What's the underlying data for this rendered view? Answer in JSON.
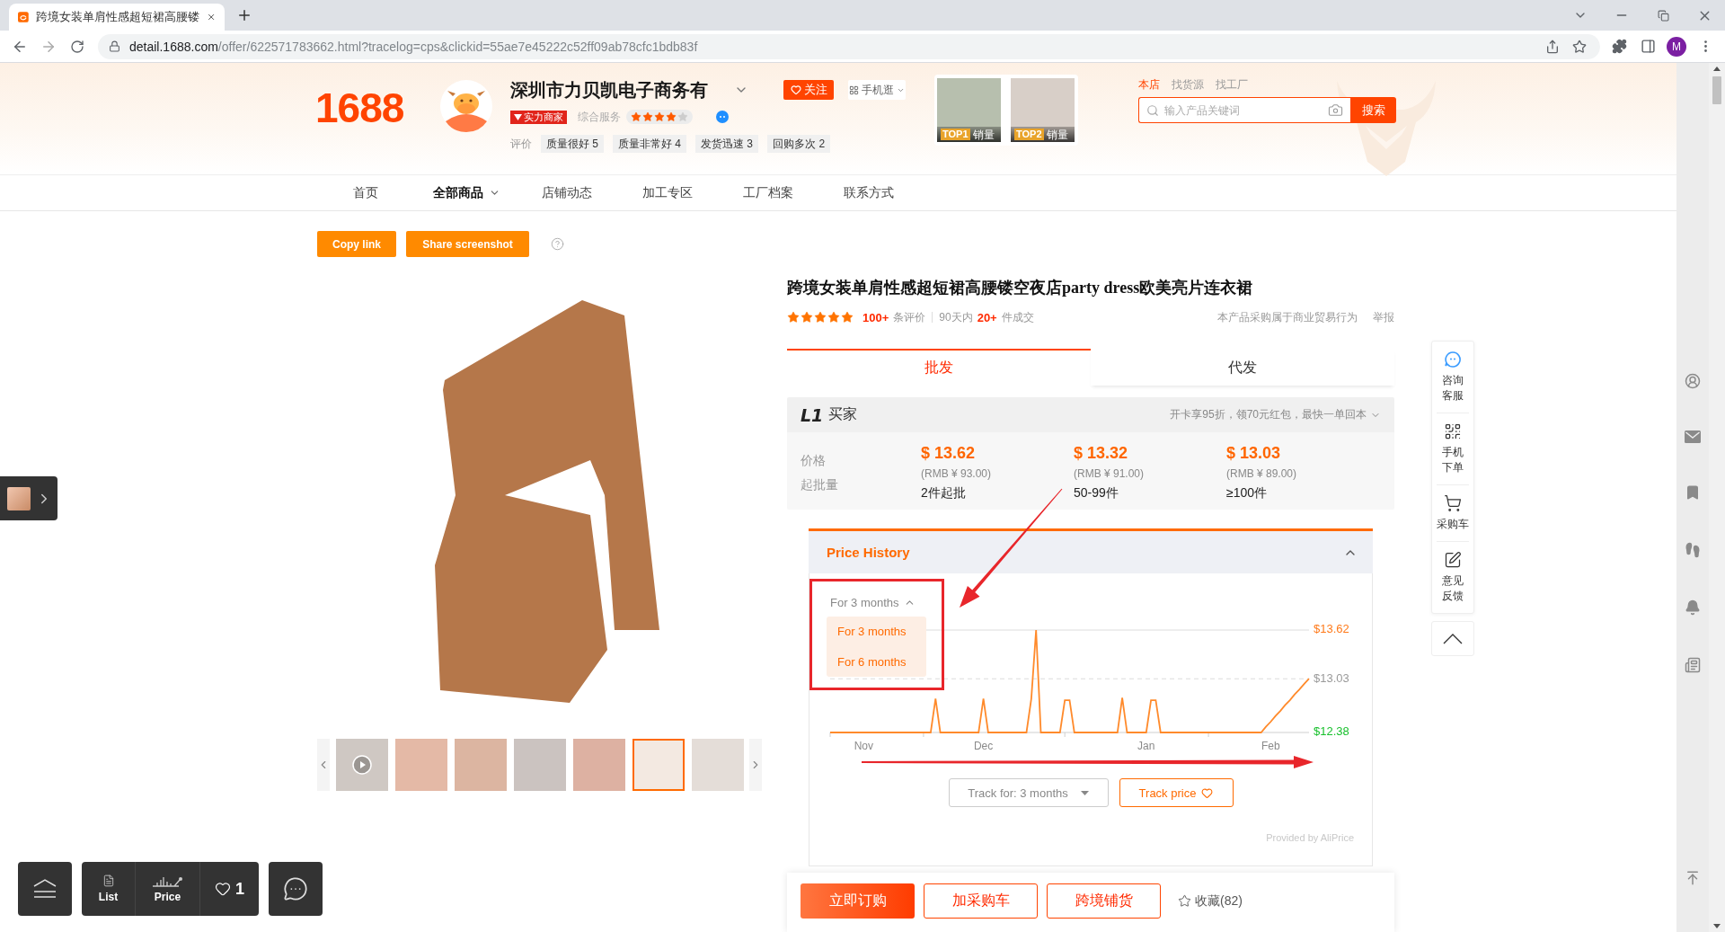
{
  "browser": {
    "tab_title": "跨境女装单肩性感超短裙高腰镂",
    "url": "detail.1688.com/offer/622571783662.html?tracelog=cps&clickid=55ae7e45222c52ff09ab78cfc1bdb83f",
    "profile_initial": "M"
  },
  "store": {
    "logo": "1688",
    "name": "深圳市力贝凯电子商务有",
    "badge": "实力商家",
    "service": {
      "label": "综合服务",
      "stars": 4
    },
    "follow": "关注",
    "mobile": "手机逛",
    "reviews_label": "评价",
    "review_tags": [
      "质量很好 5",
      "质量非常好 4",
      "发货迅速 3",
      "回购多次 2"
    ],
    "top_products": [
      {
        "rank": "TOP1",
        "metric": "销量"
      },
      {
        "rank": "TOP2",
        "metric": "销量"
      }
    ]
  },
  "search": {
    "scopes": [
      {
        "label": "本店",
        "selected": true
      },
      {
        "label": "找货源",
        "selected": false
      },
      {
        "label": "找工厂",
        "selected": false
      }
    ],
    "placeholder": "输入产品关键词",
    "button": "搜索"
  },
  "nav": [
    {
      "label": "首页",
      "selected": false,
      "has_menu": false
    },
    {
      "label": "全部商品",
      "selected": true,
      "has_menu": true
    },
    {
      "label": "店铺动态",
      "selected": false,
      "has_menu": false
    },
    {
      "label": "加工专区",
      "selected": false,
      "has_menu": false
    },
    {
      "label": "工厂档案",
      "selected": false,
      "has_menu": false
    },
    {
      "label": "联系方式",
      "selected": false,
      "has_menu": false
    }
  ],
  "share_buttons": [
    "Copy link",
    "Share screenshot"
  ],
  "gallery": {
    "thumbnails": [
      {
        "kind": "video",
        "selected": false
      },
      {
        "kind": "photo",
        "selected": false
      },
      {
        "kind": "photo",
        "selected": false
      },
      {
        "kind": "photo",
        "selected": false
      },
      {
        "kind": "photo",
        "selected": false
      },
      {
        "kind": "photo",
        "selected": true
      },
      {
        "kind": "photo",
        "selected": false
      }
    ]
  },
  "product": {
    "title": "跨境女装单肩性感超短裙高腰镂空夜店party dress欧美亮片连衣裙",
    "stars": 5,
    "review_count": "100+",
    "review_label": "条评价",
    "period": "90天内",
    "sold_count": "20+",
    "sold_label": "件成交",
    "notice": "本产品采购属于商业贸易行为",
    "report": "举报"
  },
  "mode_tabs": [
    {
      "label": "批发",
      "selected": true
    },
    {
      "label": "代发",
      "selected": false
    }
  ],
  "price_panel": {
    "member_level": "L1",
    "member_label": "买家",
    "promo": "开卡享95折，领70元红包，最快一单回本",
    "row_labels": [
      "价格",
      "起批量"
    ],
    "tiers": [
      {
        "price": "$ 13.62",
        "rmb": "(RMB ¥ 93.00)",
        "quantity": "2件起批"
      },
      {
        "price": "$ 13.32",
        "rmb": "(RMB ¥ 91.00)",
        "quantity": "50-99件"
      },
      {
        "price": "$ 13.03",
        "rmb": "(RMB ¥ 89.00)",
        "quantity": "≥100件"
      }
    ]
  },
  "price_history": {
    "title": "Price History",
    "expanded": true,
    "period": "For 3 months",
    "period_menu_open": true,
    "period_options": [
      "For 3 months",
      "For 6 months"
    ],
    "chart_data": {
      "type": "line",
      "categories": [
        null,
        null,
        null,
        null,
        null,
        null,
        null,
        "Nov",
        null,
        null,
        null,
        null,
        null,
        null,
        null,
        null,
        null,
        null,
        null,
        null,
        null,
        null,
        null,
        null,
        null,
        null,
        null,
        null,
        null,
        null,
        null,
        null,
        "Dec",
        null,
        null,
        null,
        null,
        null,
        null,
        null,
        null,
        null,
        null,
        null,
        null,
        null,
        null,
        null,
        null,
        null,
        null,
        null,
        null,
        null,
        null,
        null,
        null,
        null,
        null,
        null,
        null,
        null,
        null,
        null,
        null,
        null,
        "Jan",
        null,
        null,
        null,
        null,
        null,
        null,
        null,
        null,
        null,
        null,
        null,
        null,
        null,
        null,
        null,
        null,
        null,
        null,
        null,
        null,
        null,
        null,
        null,
        null,
        null,
        "Feb",
        null,
        null,
        null,
        null,
        null,
        null,
        null,
        null
      ],
      "series": [
        {
          "color": "#ff8a2b",
          "values": [
            12.38,
            12.38,
            12.38,
            12.38,
            12.38,
            12.38,
            12.38,
            12.38,
            12.38,
            12.38,
            12.38,
            12.38,
            12.38,
            12.38,
            12.38,
            12.38,
            12.38,
            12.38,
            12.38,
            12.38,
            12.38,
            12.38,
            12.79,
            12.38,
            12.38,
            12.38,
            12.38,
            12.38,
            12.38,
            12.38,
            12.38,
            12.38,
            12.79,
            12.38,
            12.38,
            12.38,
            12.38,
            12.38,
            12.38,
            12.38,
            12.38,
            12.38,
            12.79,
            13.62,
            12.38,
            12.38,
            12.38,
            12.38,
            12.38,
            12.77,
            12.77,
            12.38,
            12.38,
            12.38,
            12.38,
            12.38,
            12.38,
            12.38,
            12.38,
            12.38,
            12.38,
            12.8,
            12.38,
            12.38,
            12.38,
            12.38,
            12.38,
            12.77,
            12.77,
            12.38,
            12.38,
            12.38,
            12.38,
            12.38,
            12.38,
            12.38,
            12.38,
            12.38,
            12.38,
            12.38,
            12.38,
            12.38,
            12.38,
            12.38,
            12.38,
            12.38,
            12.38,
            12.38,
            12.38,
            12.38,
            12.38,
            12.45,
            12.51,
            12.58,
            12.64,
            12.71,
            12.77,
            12.84,
            12.9,
            12.97,
            13.03
          ]
        }
      ],
      "ylim": [
        12.38,
        13.62
      ],
      "yticks": [
        {
          "value": 12.38,
          "label": "$12.38"
        },
        {
          "value": 13.03,
          "label": "$13.03"
        },
        {
          "value": 13.62,
          "label": "$13.62"
        }
      ]
    },
    "track_period": "Track for: 3 months",
    "track_button": "Track price",
    "credit": "Provided by AliPrice"
  },
  "actions": {
    "buttons": [
      {
        "label": "立即订购",
        "kind": "primary"
      },
      {
        "label": "加采购车",
        "kind": "outline"
      },
      {
        "label": "跨境铺货",
        "kind": "outline"
      }
    ],
    "favorite": "收藏(82)"
  },
  "service_panel": [
    {
      "lines": [
        "咨询",
        "客服"
      ]
    },
    {
      "lines": [
        "手机",
        "下单"
      ]
    },
    {
      "lines": [
        "采购车"
      ]
    },
    {
      "lines": [
        "意见",
        "反馈"
      ]
    }
  ],
  "float_toolbar": {
    "items": [
      "List",
      "Price"
    ],
    "favorites": "1"
  }
}
